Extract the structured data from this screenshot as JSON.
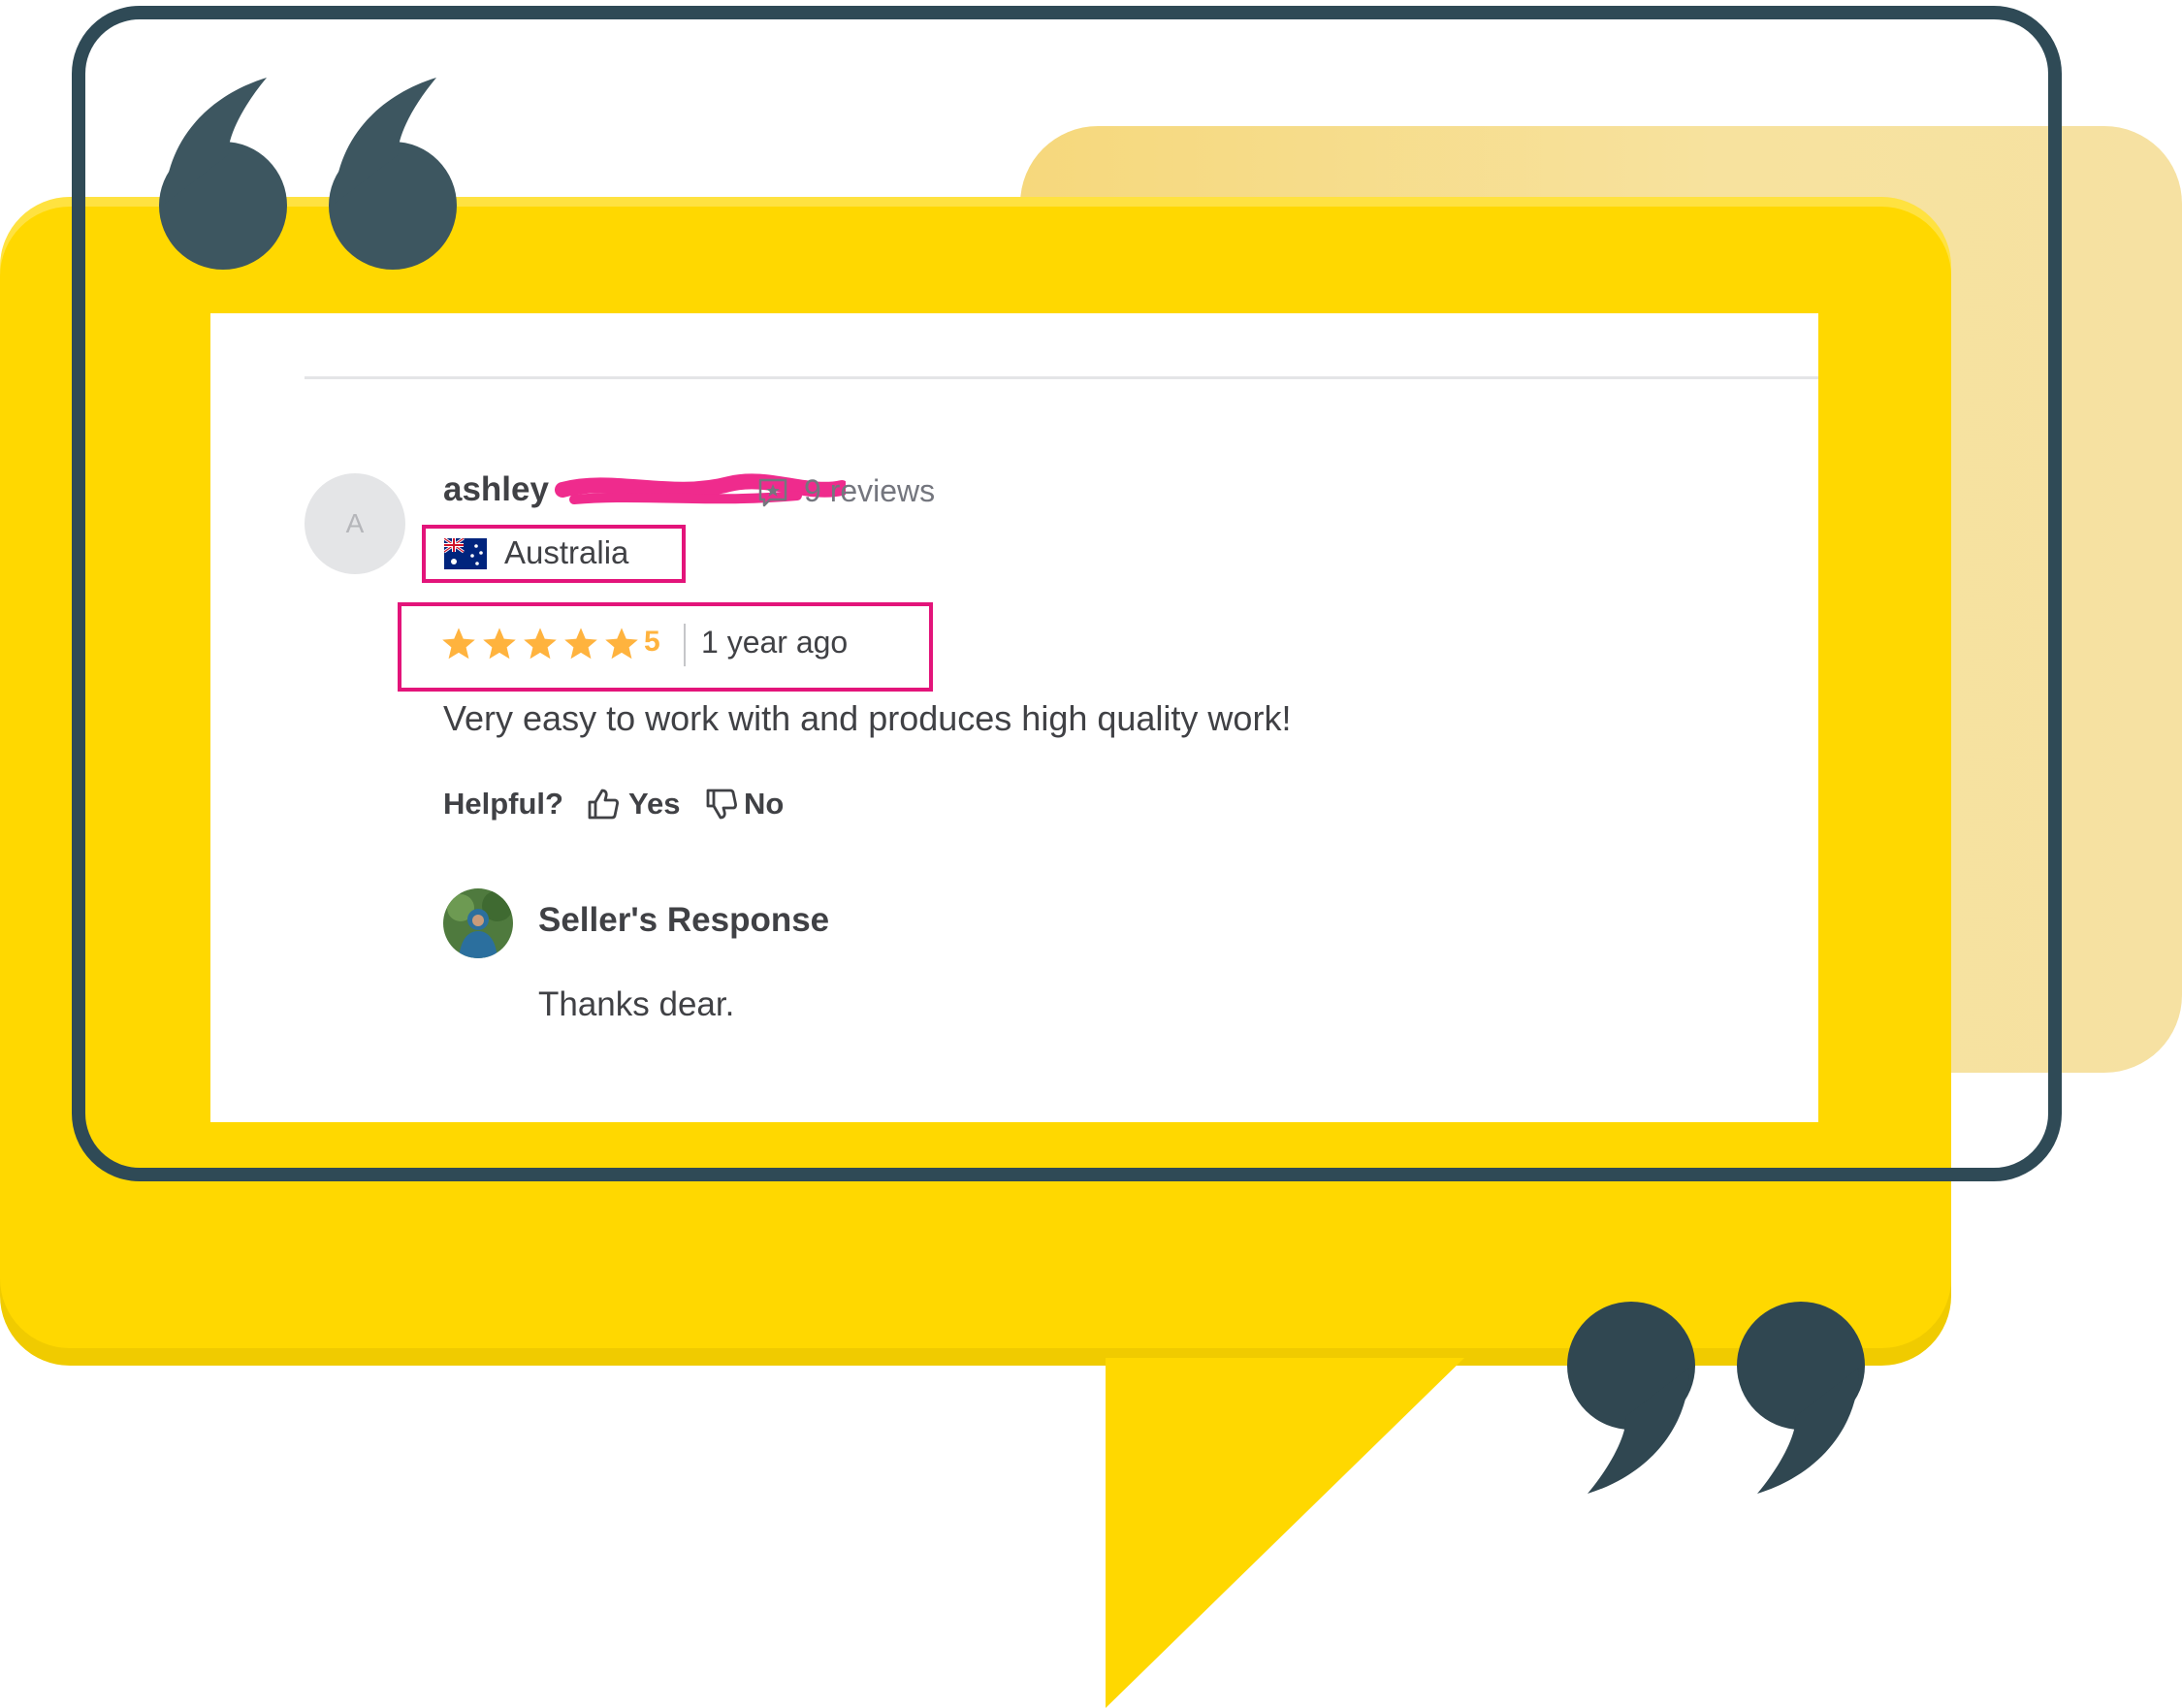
{
  "review": {
    "reviewer_initial": "A",
    "reviewer_name": "ashley",
    "reviews_count": "9 reviews",
    "country": "Australia",
    "rating": "5",
    "star_count": 5,
    "time_ago": "1 year ago",
    "text": "Very easy to work with and produces high quality work!",
    "helpful_label": "Helpful?",
    "yes_label": "Yes",
    "no_label": "No"
  },
  "seller_response": {
    "title": "Seller's Response",
    "text": "Thanks dear."
  },
  "colors": {
    "bubble_yellow": "#ffd800",
    "frame_dark": "#2f4a56",
    "highlight_pink": "#e3147a",
    "star_orange": "#ffb33e",
    "text_dark": "#404145",
    "text_muted": "#74767e"
  },
  "icons": {
    "open_quote": "open-quote-icon",
    "close_quote": "close-quote-icon",
    "reviews": "star-in-speech-bubble-icon",
    "flag": "australia-flag-icon",
    "star": "star-icon",
    "thumb_up": "thumbs-up-icon",
    "thumb_down": "thumbs-down-icon"
  }
}
